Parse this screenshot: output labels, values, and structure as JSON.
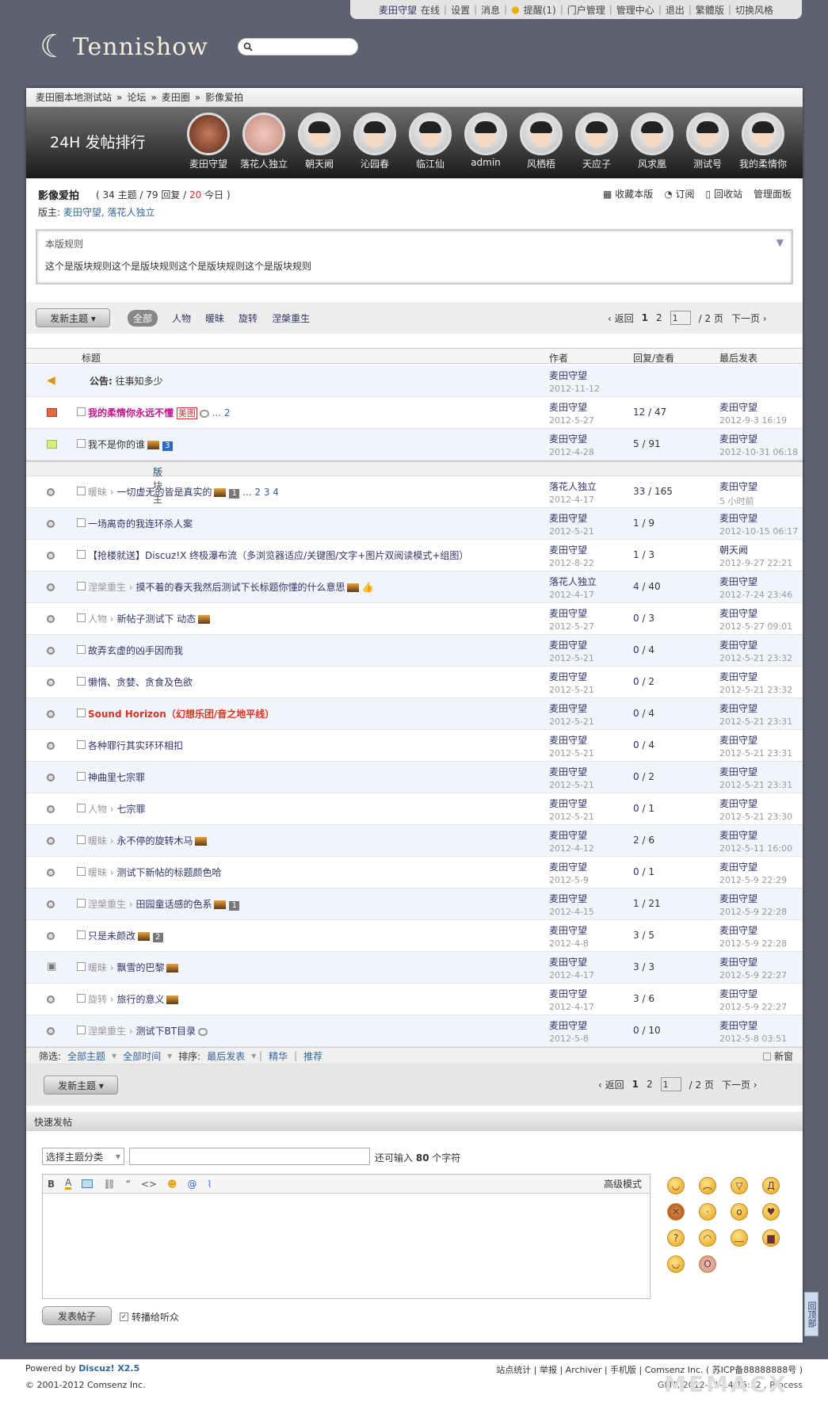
{
  "topbar": {
    "user": "麦田守望",
    "status": "在线",
    "items": [
      "设置",
      "消息",
      "提醒(1)",
      "门户管理",
      "管理中心",
      "退出",
      "繁體版",
      "切换风格"
    ]
  },
  "logo": {
    "text": "Tennishow"
  },
  "breadcrumb": [
    "麦田圈本地测试站",
    "论坛",
    "麦田圈",
    "影像爱拍"
  ],
  "ranking": {
    "title": "24H 发帖排行",
    "users": [
      "麦田守望",
      "落花人独立",
      "朝天阙",
      "沁园春",
      "临江仙",
      "admin",
      "风栖梧",
      "天应子",
      "风求凰",
      "测试号",
      "我的柔情你"
    ]
  },
  "forum": {
    "name": "影像爱拍",
    "stats_pre": "( 34 主题 / 79 回复 /",
    "today_num": "20",
    "stats_post": "今日 )",
    "mods_label": "版主:",
    "mods": "麦田守望, 落花人独立",
    "actions": [
      "收藏本版",
      "订阅",
      "回收站",
      "管理面板"
    ]
  },
  "rules": {
    "title": "本版规则",
    "body": "这个是版块规则这个是版块规则这个是版块规则这个是版块规则"
  },
  "toolbar": {
    "new_post": "发新主题 ▾",
    "filters": [
      "全部",
      "人物",
      "暖昧",
      "旋转",
      "涅槃重生"
    ],
    "back": "返回",
    "pages": [
      "1",
      "2"
    ],
    "page_input": "1",
    "total": "/ 2 页",
    "next": "下一页"
  },
  "table_headers": {
    "title": "标题",
    "author": "作者",
    "reply": "回复/查看",
    "last": "最后发表"
  },
  "announcement": {
    "label": "公告:",
    "title": "往事知多少",
    "author": "麦田守望",
    "date": "2012-11-12"
  },
  "sticky": [
    {
      "title": "我的柔情你永远不懂",
      "extra": "美图",
      "pages": "... 2",
      "author": "麦田守望",
      "date": "2012-5-27",
      "replies": "12",
      "views": "47",
      "last_user": "麦田守望",
      "last_time": "2012-9-3 16:19"
    },
    {
      "title": "我不是你的谁",
      "badge": "3",
      "author": "麦田守望",
      "date": "2012-4-28",
      "replies": "5",
      "views": "91",
      "last_user": "麦田守望",
      "last_time": "2012-10-31 06:18"
    }
  ],
  "section_label": "版块主题",
  "threads": [
    {
      "type": "暖昧",
      "title": "一切虚无的皆是真实的",
      "pages": "... 2  3  4",
      "badge": "1",
      "author": "落花人独立",
      "date": "2012-4-17",
      "replies": "33",
      "views": "165",
      "last_user": "麦田守望",
      "last_time": "5 小时前"
    },
    {
      "type": "",
      "title": "一场离奇的我连环杀人案",
      "author": "麦田守望",
      "date": "2012-5-21",
      "replies": "1",
      "views": "9",
      "last_user": "麦田守望",
      "last_time": "2012-10-15 06:17"
    },
    {
      "type": "",
      "title": "【抢楼就送】Discuz!X 终极瀑布流（多浏览器适应/关键图/文字+图片双阅读模式+组图）",
      "author": "麦田守望",
      "date": "2012-8-22",
      "replies": "1",
      "views": "3",
      "last_user": "朝天阙",
      "last_time": "2012-9-27 22:21"
    },
    {
      "type": "涅槃重生",
      "title": "摸不着的春天我然后测试下长标题你懂的什么意思",
      "author": "落花人独立",
      "date": "2012-4-17",
      "replies": "4",
      "views": "40",
      "last_user": "麦田守望",
      "last_time": "2012-7-24 23:46"
    },
    {
      "type": "人物",
      "title": "新帖子测试下 动态",
      "author": "麦田守望",
      "date": "2012-5-27",
      "replies": "0",
      "views": "3",
      "last_user": "麦田守望",
      "last_time": "2012-5-27 09:01"
    },
    {
      "type": "",
      "title": "故弄玄虚的凶手因而我",
      "author": "麦田守望",
      "date": "2012-5-21",
      "replies": "0",
      "views": "4",
      "last_user": "麦田守望",
      "last_time": "2012-5-21 23:32"
    },
    {
      "type": "",
      "title": "懒惰、贪婪、贪食及色欲",
      "author": "麦田守望",
      "date": "2012-5-21",
      "replies": "0",
      "views": "2",
      "last_user": "麦田守望",
      "last_time": "2012-5-21 23:32"
    },
    {
      "type": "",
      "title": "Sound Horizon（幻想乐团/音之地平线）",
      "author": "麦田守望",
      "date": "2012-5-21",
      "replies": "0",
      "views": "4",
      "last_user": "麦田守望",
      "last_time": "2012-5-21 23:31"
    },
    {
      "type": "",
      "title": "各种罪行其实环环相扣",
      "author": "麦田守望",
      "date": "2012-5-21",
      "replies": "0",
      "views": "4",
      "last_user": "麦田守望",
      "last_time": "2012-5-21 23:31"
    },
    {
      "type": "",
      "title": "神曲里七宗罪",
      "author": "麦田守望",
      "date": "2012-5-21",
      "replies": "0",
      "views": "2",
      "last_user": "麦田守望",
      "last_time": "2012-5-21 23:31"
    },
    {
      "type": "人物",
      "title": "七宗罪",
      "author": "麦田守望",
      "date": "2012-5-21",
      "replies": "0",
      "views": "1",
      "last_user": "麦田守望",
      "last_time": "2012-5-21 23:30"
    },
    {
      "type": "暖昧",
      "title": "永不停的旋转木马",
      "author": "麦田守望",
      "date": "2012-4-12",
      "replies": "2",
      "views": "6",
      "last_user": "麦田守望",
      "last_time": "2012-5-11 16:00"
    },
    {
      "type": "暖昧",
      "title": "测试下新帖的标题颜色哈",
      "author": "麦田守望",
      "date": "2012-5-9",
      "replies": "0",
      "views": "1",
      "last_user": "麦田守望",
      "last_time": "2012-5-9 22:29"
    },
    {
      "type": "涅槃重生",
      "title": "田园童话感的色系",
      "badge": "1",
      "author": "麦田守望",
      "date": "2012-4-15",
      "replies": "1",
      "views": "21",
      "last_user": "麦田守望",
      "last_time": "2012-5-9 22:28"
    },
    {
      "type": "",
      "title": "只是未颜改",
      "badge": "2",
      "author": "麦田守望",
      "date": "2012-4-8",
      "replies": "3",
      "views": "5",
      "last_user": "麦田守望",
      "last_time": "2012-5-9 22:28"
    },
    {
      "type": "暖昧",
      "title": "飘雪的巴黎",
      "author": "麦田守望",
      "date": "2012-4-17",
      "replies": "3",
      "views": "3",
      "last_user": "麦田守望",
      "last_time": "2012-5-9 22:27"
    },
    {
      "type": "旋转",
      "title": "旅行的意义",
      "author": "麦田守望",
      "date": "2012-4-17",
      "replies": "3",
      "views": "6",
      "last_user": "麦田守望",
      "last_time": "2012-5-9 22:27"
    },
    {
      "type": "涅槃重生",
      "title": "测试下BT目录",
      "author": "麦田守望",
      "date": "2012-5-8",
      "replies": "0",
      "views": "10",
      "last_user": "麦田守望",
      "last_time": "2012-5-8 03:51"
    }
  ],
  "sortbar": {
    "filter_label": "筛选:",
    "all_topics": "全部主题",
    "all_time": "全部时间",
    "sort_label": "排序:",
    "last_post": "最后发表",
    "digest": "精华",
    "recommend": "推荐",
    "new_window": "新窗"
  },
  "quickpost": {
    "title": "快速发帖",
    "category": "选择主题分类",
    "count_pre": "还可输入",
    "count_num": "80",
    "count_post": "个字符",
    "advanced": "高级模式",
    "submit": "发表帖子",
    "relay": "转播给听众"
  },
  "footer": {
    "powered": "Powered by",
    "product": "Discuz! X2.5",
    "copyright": "© 2001-2012 Comsenz Inc.",
    "links": "站点统计 | 举报 | Archiver | 手机版 | Comsenz Inc. ( 苏ICP备88888888号 )",
    "time": "GMT, 2012-11-14 15:12 , Process"
  },
  "backtop": "回顶部"
}
